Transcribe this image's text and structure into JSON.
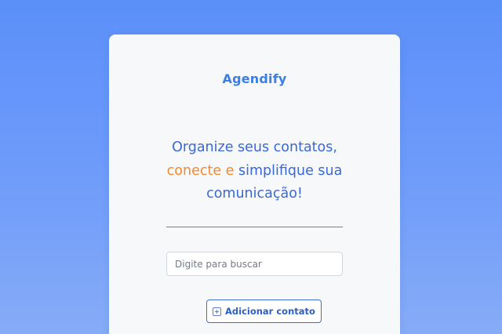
{
  "app": {
    "brand_name": "Agendify"
  },
  "headline": {
    "part1": "Organize seus contatos,",
    "part2_accent": "conecte e",
    "part2_rest": " simplifique sua",
    "part3": "comunicação!"
  },
  "search": {
    "placeholder": "Digite para buscar",
    "value": ""
  },
  "actions": {
    "add_contact_label": "Adicionar contato",
    "add_contact_icon": "plus-square-icon"
  },
  "colors": {
    "background_top": "#5b8ff9",
    "background_bottom": "#86acf7",
    "brand": "#3a7ee6",
    "headline": "#3b68d4",
    "accent": "#f08a35",
    "button_border": "#3a6fd8"
  }
}
